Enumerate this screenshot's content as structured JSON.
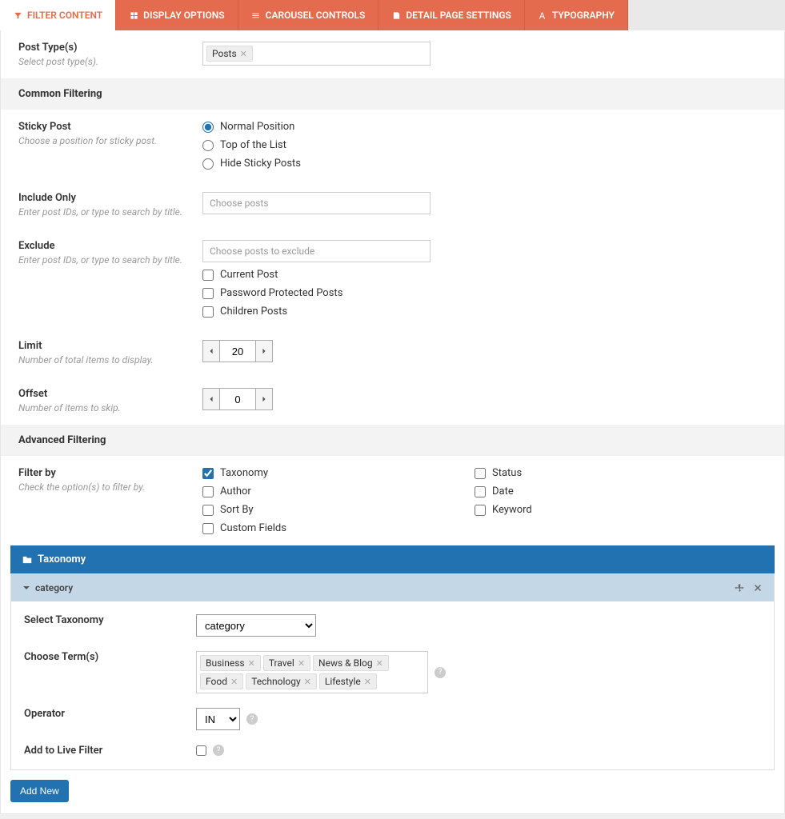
{
  "tabs": {
    "filter_content": "FILTER CONTENT",
    "display_options": "DISPLAY OPTIONS",
    "carousel_controls": "CAROUSEL CONTROLS",
    "detail_page_settings": "DETAIL PAGE SETTINGS",
    "typography": "TYPOGRAPHY"
  },
  "post_types": {
    "label": "Post Type(s)",
    "desc": "Select post type(s).",
    "tags": [
      "Posts"
    ]
  },
  "sections": {
    "common_filtering": "Common Filtering",
    "advanced_filtering": "Advanced Filtering"
  },
  "sticky": {
    "label": "Sticky Post",
    "desc": "Choose a position for sticky post.",
    "options": [
      "Normal Position",
      "Top of the List",
      "Hide Sticky Posts"
    ]
  },
  "include": {
    "label": "Include Only",
    "desc": "Enter post IDs, or type to search by title.",
    "placeholder": "Choose posts"
  },
  "exclude": {
    "label": "Exclude",
    "desc": "Enter post IDs, or type to search by title.",
    "placeholder": "Choose posts to exclude",
    "checks": [
      "Current Post",
      "Password Protected Posts",
      "Children Posts"
    ]
  },
  "limit": {
    "label": "Limit",
    "desc": "Number of total items to display.",
    "value": "20"
  },
  "offset": {
    "label": "Offset",
    "desc": "Number of items to skip.",
    "value": "0"
  },
  "filter_by": {
    "label": "Filter by",
    "desc": "Check the option(s) to filter by.",
    "col1": [
      "Taxonomy",
      "Author",
      "Sort By",
      "Custom Fields"
    ],
    "col2": [
      "Status",
      "Date",
      "Keyword"
    ]
  },
  "taxonomy": {
    "bar_title": "Taxonomy",
    "accordion_title": "category",
    "select_label": "Select Taxonomy",
    "select_value": "category",
    "choose_label": "Choose Term(s)",
    "terms": [
      "Business",
      "Travel",
      "News & Blog",
      "Food",
      "Technology",
      "Lifestyle"
    ],
    "operator_label": "Operator",
    "operator_value": "IN",
    "live_filter_label": "Add to Live Filter",
    "add_new": "Add New"
  }
}
